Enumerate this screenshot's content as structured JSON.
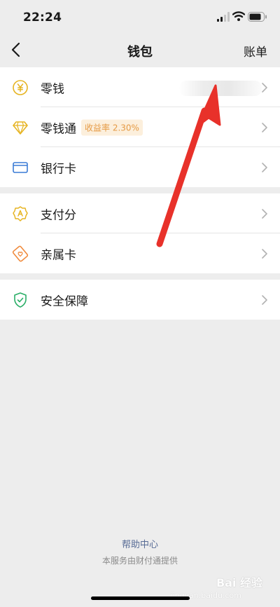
{
  "status_bar": {
    "time": "22:24",
    "icons": [
      "signal-icon",
      "wifi-icon",
      "battery-icon"
    ]
  },
  "nav": {
    "title": "钱包",
    "action": "账单",
    "back_icon": "chevron-left-icon"
  },
  "groups": [
    {
      "items": [
        {
          "label": "零钱",
          "icon": "yuan-coin-icon",
          "icon_color": "#e6b422",
          "value_hidden": true
        },
        {
          "label": "零钱通",
          "icon": "diamond-icon",
          "icon_color": "#e6b422",
          "badge": "收益率 2.30%"
        },
        {
          "label": "银行卡",
          "icon": "bank-card-icon",
          "icon_color": "#3a7bd5"
        }
      ]
    },
    {
      "items": [
        {
          "label": "支付分",
          "icon": "payscore-badge-icon",
          "icon_color": "#e6b422"
        },
        {
          "label": "亲属卡",
          "icon": "family-card-icon",
          "icon_color": "#f08a3c"
        }
      ]
    },
    {
      "items": [
        {
          "label": "安全保障",
          "icon": "shield-check-icon",
          "icon_color": "#2aae67"
        }
      ]
    }
  ],
  "footer": {
    "help_link": "帮助中心",
    "service_note": "本服务由财付通提供"
  },
  "watermark": {
    "main": "Bai 经验",
    "sub": "jingyan.baidu.com"
  },
  "colors": {
    "background": "#ededed",
    "card": "#ffffff",
    "link": "#576b95",
    "annotation_arrow": "#e8312a",
    "badge_bg": "#fcefdc",
    "badge_text": "#e59a44"
  }
}
